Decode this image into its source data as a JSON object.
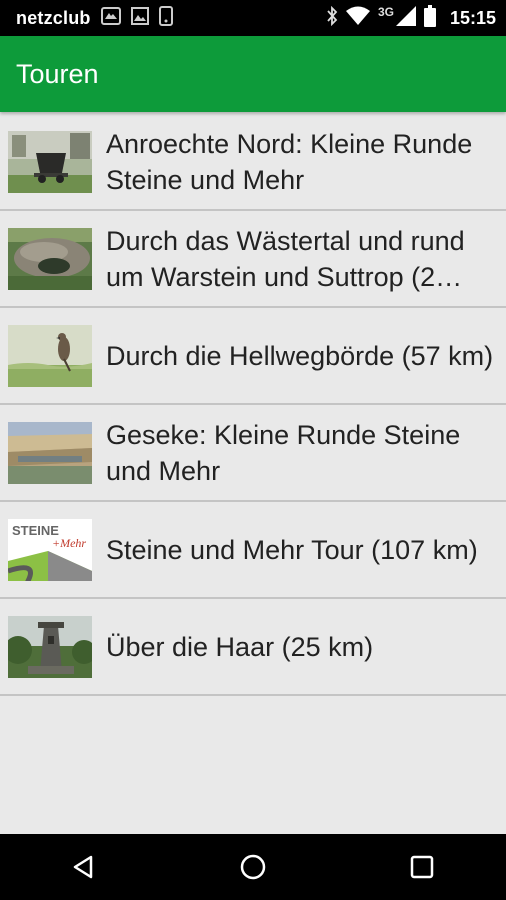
{
  "status_bar": {
    "carrier": "netzclub",
    "network_type": "3G",
    "time": "15:15",
    "icons_left": [
      "mail-icon",
      "image-icon",
      "phone-icon"
    ],
    "icons_right": [
      "bluetooth-icon",
      "wifi-icon",
      "signal-icon",
      "battery-icon"
    ]
  },
  "app_bar": {
    "title": "Touren",
    "color": "#0d9b3a"
  },
  "tours": [
    {
      "title": "Anroechte Nord: Kleine Runde Steine und Mehr",
      "thumbnail": "railcar-photo"
    },
    {
      "title": "Durch das Wästertal und rund um Warstein und Suttrop (2…",
      "thumbnail": "rock-photo"
    },
    {
      "title": "Durch die Hellwegbörde (57 km)",
      "thumbnail": "bird-photo"
    },
    {
      "title": "Geseke: Kleine Runde Steine und Mehr",
      "thumbnail": "quarry-photo"
    },
    {
      "title": "Steine und Mehr Tour (107 km)",
      "thumbnail": "steine-logo",
      "logo_text": [
        "STEINE",
        "+Mehr"
      ]
    },
    {
      "title": "Über die Haar (25 km)",
      "thumbnail": "tower-photo"
    }
  ],
  "nav_bar": {
    "buttons": [
      "back-icon",
      "home-icon",
      "recents-icon"
    ]
  }
}
